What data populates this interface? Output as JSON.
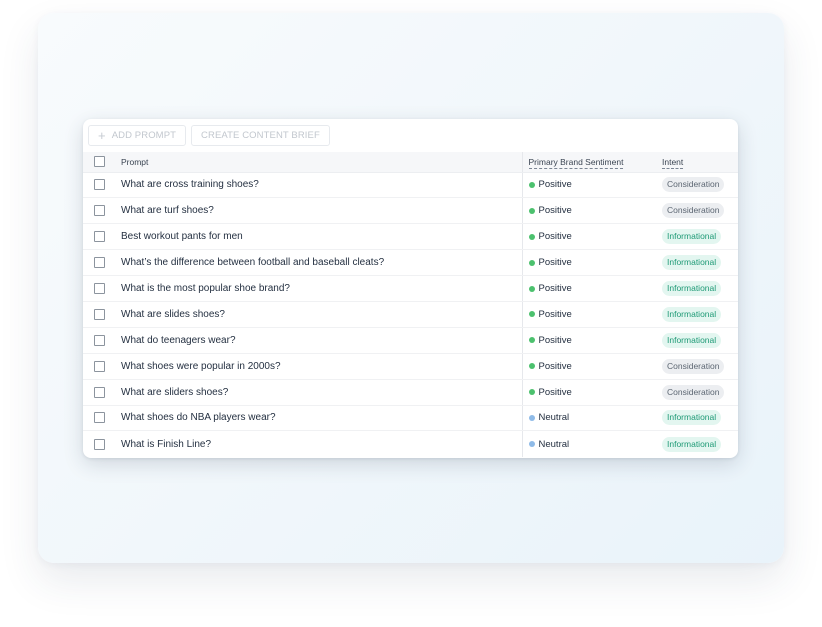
{
  "toolbar": {
    "add_prompt_label": "ADD PROMPT",
    "create_brief_label": "CREATE CONTENT BRIEF"
  },
  "table": {
    "headers": {
      "prompt": "Prompt",
      "sentiment": "Primary Brand Sentiment",
      "intent": "Intent"
    },
    "rows": [
      {
        "prompt": "What are cross training shoes?",
        "sentiment": "Positive",
        "intent": "Consideration"
      },
      {
        "prompt": "What are turf shoes?",
        "sentiment": "Positive",
        "intent": "Consideration"
      },
      {
        "prompt": "Best workout pants for men",
        "sentiment": "Positive",
        "intent": "Informational"
      },
      {
        "prompt": "What’s the difference between football and baseball cleats?",
        "sentiment": "Positive",
        "intent": "Informational"
      },
      {
        "prompt": "What is the most popular shoe brand?",
        "sentiment": "Positive",
        "intent": "Informational"
      },
      {
        "prompt": "What are slides shoes?",
        "sentiment": "Positive",
        "intent": "Informational"
      },
      {
        "prompt": "What do teenagers wear?",
        "sentiment": "Positive",
        "intent": "Informational"
      },
      {
        "prompt": "What shoes were popular in 2000s?",
        "sentiment": "Positive",
        "intent": "Consideration"
      },
      {
        "prompt": "What are sliders shoes?",
        "sentiment": "Positive",
        "intent": "Consideration"
      },
      {
        "prompt": "What shoes do NBA players wear?",
        "sentiment": "Neutral",
        "intent": "Informational"
      },
      {
        "prompt": "What is Finish Line?",
        "sentiment": "Neutral",
        "intent": "Informational"
      }
    ]
  },
  "colors": {
    "positive": "#4cc16e",
    "neutral": "#8fbbe8",
    "informational_text": "#1f9a76",
    "consideration_text": "#5c6672"
  },
  "icons": {
    "add": "plus-icon"
  }
}
